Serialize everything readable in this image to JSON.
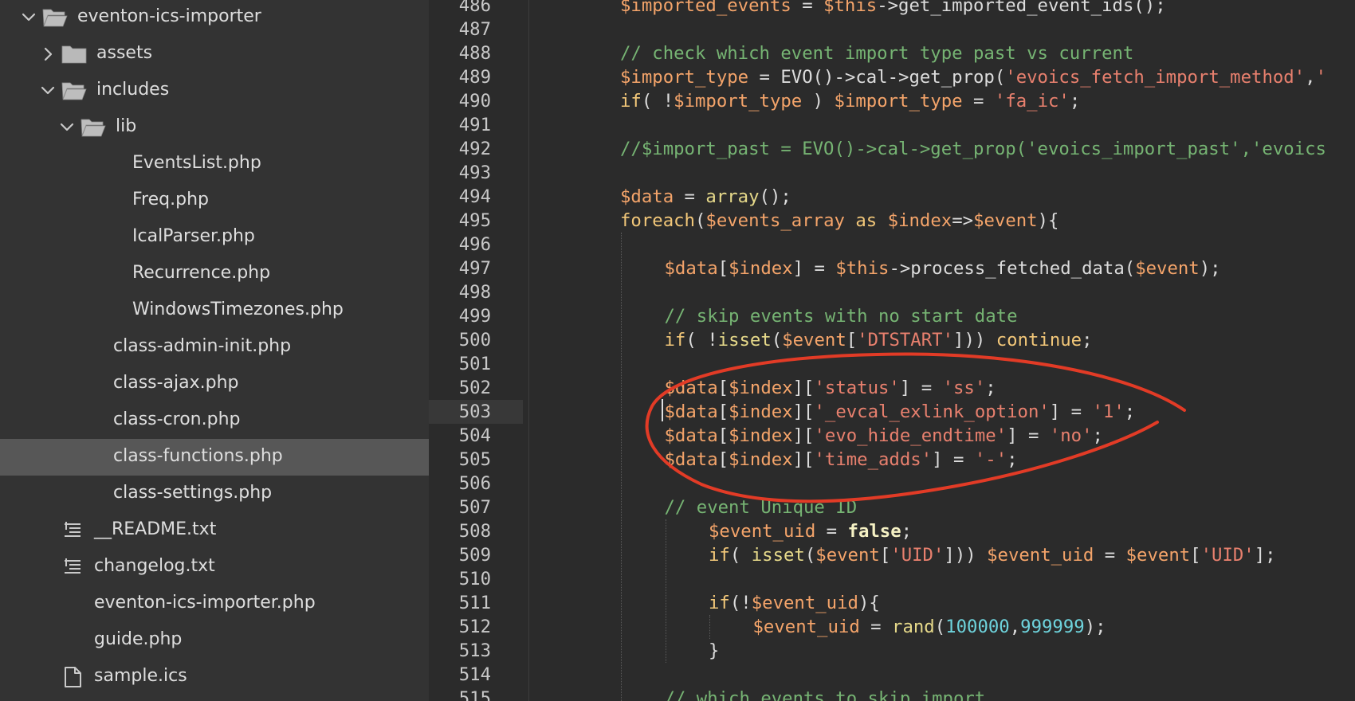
{
  "sidebar": {
    "items": [
      {
        "label": "eventon-ics-importer",
        "type": "folder",
        "expanded": true,
        "depth": 0,
        "icon": "folder-open-icon"
      },
      {
        "label": "assets",
        "type": "folder",
        "expanded": false,
        "depth": 1,
        "icon": "folder-icon"
      },
      {
        "label": "includes",
        "type": "folder",
        "expanded": true,
        "depth": 1,
        "icon": "folder-open-icon"
      },
      {
        "label": "lib",
        "type": "folder",
        "expanded": true,
        "depth": 2,
        "icon": "folder-open-icon"
      },
      {
        "label": "EventsList.php",
        "type": "file",
        "depth": 3
      },
      {
        "label": "Freq.php",
        "type": "file",
        "depth": 3
      },
      {
        "label": "IcalParser.php",
        "type": "file",
        "depth": 3
      },
      {
        "label": "Recurrence.php",
        "type": "file",
        "depth": 3
      },
      {
        "label": "WindowsTimezones.php",
        "type": "file",
        "depth": 3
      },
      {
        "label": "class-admin-init.php",
        "type": "file",
        "depth": 2
      },
      {
        "label": "class-ajax.php",
        "type": "file",
        "depth": 2
      },
      {
        "label": "class-cron.php",
        "type": "file",
        "depth": 2
      },
      {
        "label": "class-functions.php",
        "type": "file",
        "depth": 2,
        "selected": true
      },
      {
        "label": "class-settings.php",
        "type": "file",
        "depth": 2
      },
      {
        "label": "__README.txt",
        "type": "file",
        "depth": 1,
        "icon": "text-lines-icon"
      },
      {
        "label": "changelog.txt",
        "type": "file",
        "depth": 1,
        "icon": "text-lines-icon"
      },
      {
        "label": "eventon-ics-importer.php",
        "type": "file",
        "depth": 1
      },
      {
        "label": "guide.php",
        "type": "file",
        "depth": 1
      },
      {
        "label": "sample.ics",
        "type": "file",
        "depth": 1,
        "icon": "document-icon"
      }
    ]
  },
  "editor": {
    "current_line": 503,
    "lines": [
      {
        "n": "486",
        "indent": 0,
        "tokens": [
          [
            "var",
            "$imported_events"
          ],
          [
            "txt",
            " = "
          ],
          [
            "var",
            "$this"
          ],
          [
            "txt",
            "->get_imported_event_ids();"
          ]
        ]
      },
      {
        "n": "487",
        "indent": 0,
        "tokens": []
      },
      {
        "n": "488",
        "indent": 0,
        "tokens": [
          [
            "cmt",
            "// check which event import type past vs current"
          ]
        ]
      },
      {
        "n": "489",
        "indent": 0,
        "tokens": [
          [
            "var",
            "$import_type"
          ],
          [
            "txt",
            " = EVO()->cal->get_prop("
          ],
          [
            "str",
            "'evoics_fetch_import_method'"
          ],
          [
            "txt",
            ","
          ],
          [
            "str",
            "'"
          ]
        ]
      },
      {
        "n": "490",
        "indent": 0,
        "tokens": [
          [
            "kw",
            "if"
          ],
          [
            "txt",
            "( !"
          ],
          [
            "var",
            "$import_type"
          ],
          [
            "txt",
            " ) "
          ],
          [
            "var",
            "$import_type"
          ],
          [
            "txt",
            " = "
          ],
          [
            "str",
            "'fa_ic'"
          ],
          [
            "txt",
            ";"
          ]
        ]
      },
      {
        "n": "491",
        "indent": 0,
        "tokens": []
      },
      {
        "n": "492",
        "indent": 0,
        "tokens": [
          [
            "cmt",
            "//$import_past = EVO()->cal->get_prop('evoics_import_past','evoics"
          ]
        ]
      },
      {
        "n": "493",
        "indent": 0,
        "tokens": []
      },
      {
        "n": "494",
        "indent": 0,
        "tokens": [
          [
            "var",
            "$data"
          ],
          [
            "txt",
            " = "
          ],
          [
            "fn",
            "array"
          ],
          [
            "txt",
            "();"
          ]
        ]
      },
      {
        "n": "495",
        "indent": 0,
        "tokens": [
          [
            "kw",
            "foreach"
          ],
          [
            "txt",
            "("
          ],
          [
            "var",
            "$events_array"
          ],
          [
            "txt",
            " "
          ],
          [
            "kw",
            "as"
          ],
          [
            "txt",
            " "
          ],
          [
            "var",
            "$index"
          ],
          [
            "txt",
            "=>"
          ],
          [
            "var",
            "$event"
          ],
          [
            "txt",
            "){"
          ]
        ]
      },
      {
        "n": "496",
        "indent": 1,
        "tokens": []
      },
      {
        "n": "497",
        "indent": 1,
        "tokens": [
          [
            "var",
            "$data"
          ],
          [
            "txt",
            "["
          ],
          [
            "var",
            "$index"
          ],
          [
            "txt",
            "] = "
          ],
          [
            "var",
            "$this"
          ],
          [
            "txt",
            "->process_fetched_data("
          ],
          [
            "var",
            "$event"
          ],
          [
            "txt",
            ");"
          ]
        ]
      },
      {
        "n": "498",
        "indent": 1,
        "tokens": []
      },
      {
        "n": "499",
        "indent": 1,
        "tokens": [
          [
            "cmt",
            "// skip events with no start date"
          ]
        ]
      },
      {
        "n": "500",
        "indent": 1,
        "tokens": [
          [
            "kw",
            "if"
          ],
          [
            "txt",
            "( !"
          ],
          [
            "fn",
            "isset"
          ],
          [
            "txt",
            "("
          ],
          [
            "var",
            "$event"
          ],
          [
            "txt",
            "["
          ],
          [
            "str",
            "'DTSTART'"
          ],
          [
            "txt",
            "])) "
          ],
          [
            "kw",
            "continue"
          ],
          [
            "txt",
            ";"
          ]
        ]
      },
      {
        "n": "501",
        "indent": 1,
        "tokens": []
      },
      {
        "n": "502",
        "indent": 1,
        "tokens": [
          [
            "var",
            "$data"
          ],
          [
            "txt",
            "["
          ],
          [
            "var",
            "$index"
          ],
          [
            "txt",
            "]["
          ],
          [
            "str",
            "'status'"
          ],
          [
            "txt",
            "] = "
          ],
          [
            "str",
            "'ss'"
          ],
          [
            "txt",
            ";"
          ]
        ]
      },
      {
        "n": "503",
        "indent": 1,
        "tokens": [
          [
            "var",
            "$data"
          ],
          [
            "txt",
            "["
          ],
          [
            "var",
            "$index"
          ],
          [
            "txt",
            "]["
          ],
          [
            "str",
            "'_evcal_exlink_option'"
          ],
          [
            "txt",
            "] = "
          ],
          [
            "str",
            "'1'"
          ],
          [
            "txt",
            ";"
          ]
        ]
      },
      {
        "n": "504",
        "indent": 1,
        "tokens": [
          [
            "var",
            "$data"
          ],
          [
            "txt",
            "["
          ],
          [
            "var",
            "$index"
          ],
          [
            "txt",
            "]["
          ],
          [
            "str",
            "'evo_hide_endtime'"
          ],
          [
            "txt",
            "] = "
          ],
          [
            "str",
            "'no'"
          ],
          [
            "txt",
            ";"
          ]
        ]
      },
      {
        "n": "505",
        "indent": 1,
        "tokens": [
          [
            "var",
            "$data"
          ],
          [
            "txt",
            "["
          ],
          [
            "var",
            "$index"
          ],
          [
            "txt",
            "]["
          ],
          [
            "str",
            "'time_adds'"
          ],
          [
            "txt",
            "] = "
          ],
          [
            "str",
            "'-'"
          ],
          [
            "txt",
            ";"
          ]
        ]
      },
      {
        "n": "506",
        "indent": 1,
        "tokens": []
      },
      {
        "n": "507",
        "indent": 1,
        "tokens": [
          [
            "cmt",
            "// event Unique ID"
          ]
        ]
      },
      {
        "n": "508",
        "indent": 2,
        "tokens": [
          [
            "var",
            "$event_uid"
          ],
          [
            "txt",
            " = "
          ],
          [
            "bool",
            "false"
          ],
          [
            "txt",
            ";"
          ]
        ]
      },
      {
        "n": "509",
        "indent": 2,
        "tokens": [
          [
            "kw",
            "if"
          ],
          [
            "txt",
            "( "
          ],
          [
            "fn",
            "isset"
          ],
          [
            "txt",
            "("
          ],
          [
            "var",
            "$event"
          ],
          [
            "txt",
            "["
          ],
          [
            "str",
            "'UID'"
          ],
          [
            "txt",
            "])) "
          ],
          [
            "var",
            "$event_uid"
          ],
          [
            "txt",
            " = "
          ],
          [
            "var",
            "$event"
          ],
          [
            "txt",
            "["
          ],
          [
            "str",
            "'UID'"
          ],
          [
            "txt",
            "];"
          ]
        ]
      },
      {
        "n": "510",
        "indent": 2,
        "tokens": []
      },
      {
        "n": "511",
        "indent": 2,
        "tokens": [
          [
            "kw",
            "if"
          ],
          [
            "txt",
            "(!"
          ],
          [
            "var",
            "$event_uid"
          ],
          [
            "txt",
            "){"
          ]
        ]
      },
      {
        "n": "512",
        "indent": 3,
        "tokens": [
          [
            "var",
            "$event_uid"
          ],
          [
            "txt",
            " = "
          ],
          [
            "fn",
            "rand"
          ],
          [
            "txt",
            "("
          ],
          [
            "num",
            "100000"
          ],
          [
            "txt",
            ","
          ],
          [
            "num",
            "999999"
          ],
          [
            "txt",
            ");"
          ]
        ]
      },
      {
        "n": "513",
        "indent": 2,
        "tokens": [
          [
            "txt",
            "}"
          ]
        ]
      },
      {
        "n": "514",
        "indent": 1,
        "tokens": []
      },
      {
        "n": "515",
        "indent": 1,
        "tokens": [
          [
            "cmt",
            "// which events to skip import"
          ]
        ]
      }
    ]
  },
  "annotation": {
    "color": "#e23b26"
  },
  "colors": {
    "sidebar_bg": "#333333",
    "selected_row": "#575757",
    "editor_bg": "#2b2b2b"
  }
}
